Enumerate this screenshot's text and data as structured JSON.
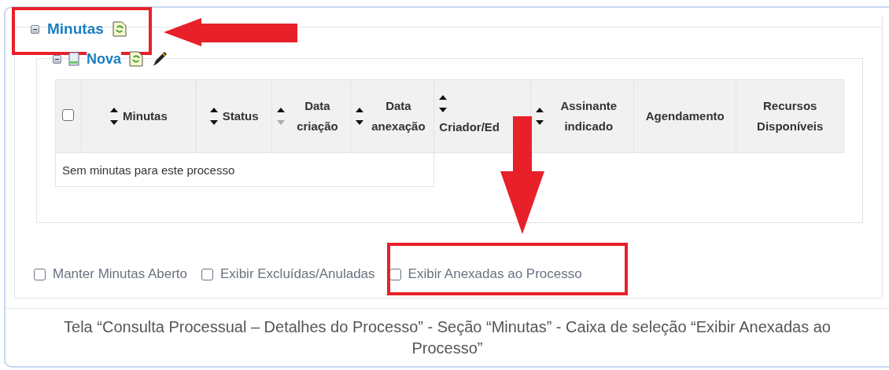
{
  "section": {
    "title": "Minutas",
    "expanded": true
  },
  "subsection": {
    "title": "Nova",
    "expanded": true
  },
  "table": {
    "select_all": {
      "checked": false
    },
    "columns": [
      {
        "label": "Minutas",
        "sortable": true,
        "sorted": false
      },
      {
        "label": "Status",
        "sortable": true,
        "sorted": false
      },
      {
        "label": "Data criação",
        "sortable": true,
        "sorted": true
      },
      {
        "label": "Data anexação",
        "sortable": true,
        "sorted": false
      },
      {
        "label": "Criador/Ed",
        "sortable": true,
        "sorted": false
      },
      {
        "label": "Assinante indicado",
        "sortable": true,
        "sorted": false
      },
      {
        "label": "Agendamento",
        "sortable": false
      },
      {
        "label": "Recursos Disponíveis",
        "sortable": false
      }
    ],
    "empty_message": "Sem minutas para este processo"
  },
  "options": [
    {
      "label": "Manter Minutas Aberto",
      "checked": false
    },
    {
      "label": "Exibir Excluídas/Anuladas",
      "checked": false
    },
    {
      "label": "Exibir Anexadas ao Processo",
      "checked": false
    }
  ],
  "caption": "Tela “Consulta Processual – Detalhes do Processo” - Seção “Minutas” - Caixa de seleção “Exibir Anexadas ao Processo”"
}
